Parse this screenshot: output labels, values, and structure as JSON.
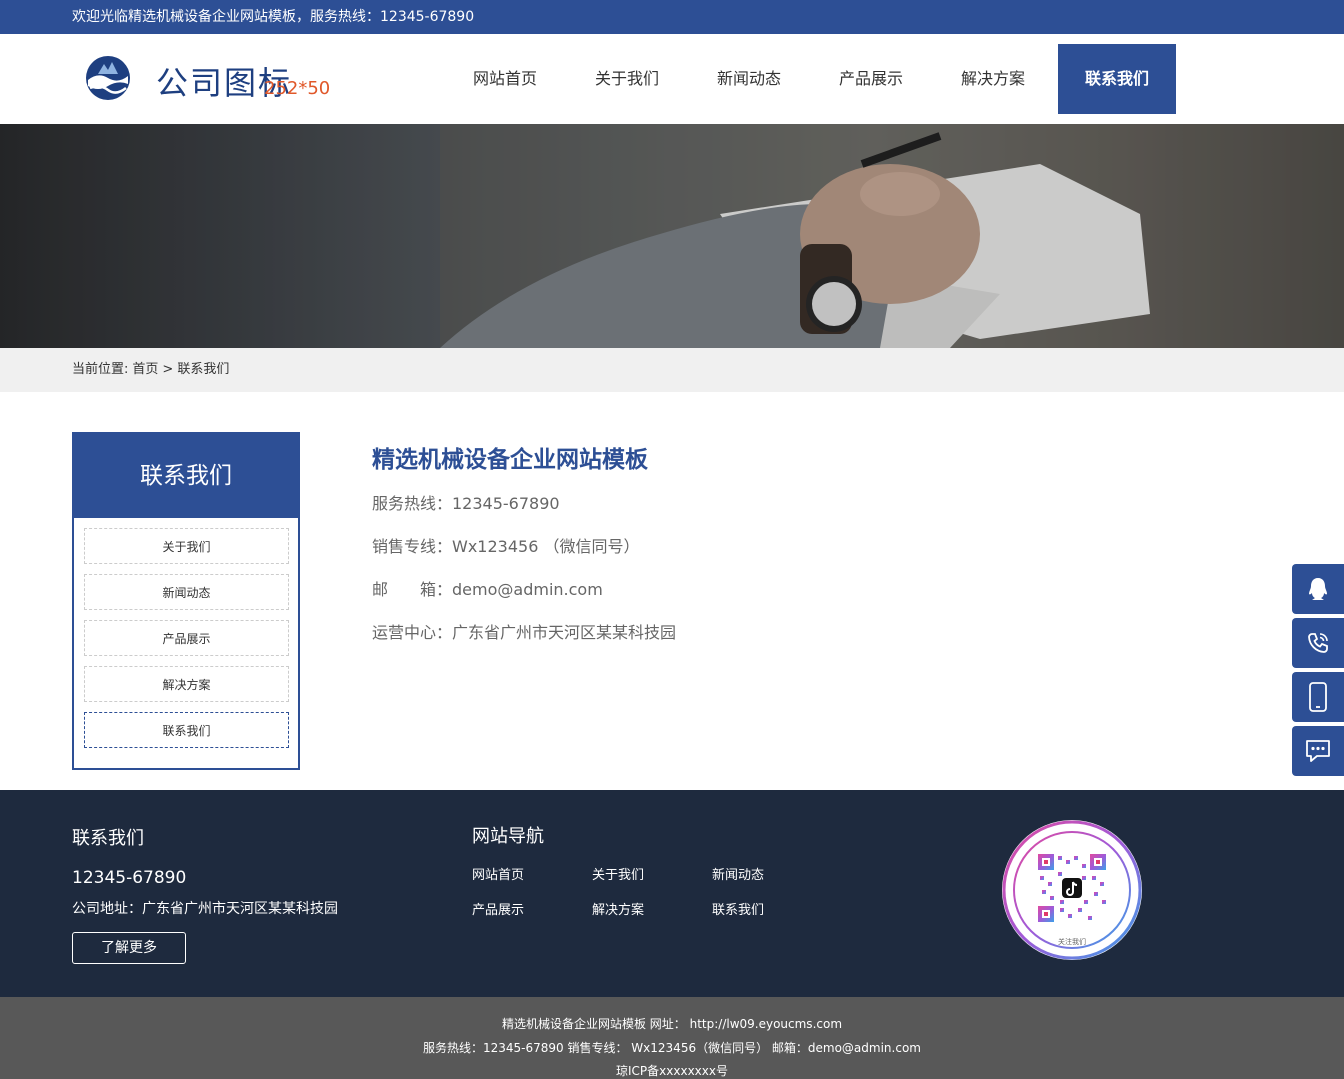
{
  "topbar": {
    "welcome": "欢迎光临精选机械设备企业网站模板，服务热线：12345-67890"
  },
  "header": {
    "logo_text": "公司图标",
    "logo_size": "252*50",
    "nav": [
      "网站首页",
      "关于我们",
      "新闻动态",
      "产品展示",
      "解决方案",
      "联系我们"
    ],
    "active_nav": "联系我们"
  },
  "breadcrumb": {
    "label": "当前位置:",
    "home": "首页",
    "sep": ">",
    "current": "联系我们"
  },
  "sidebar": {
    "title": "联系我们",
    "items": [
      "关于我们",
      "新闻动态",
      "产品展示",
      "解决方案",
      "联系我们"
    ]
  },
  "contact": {
    "title": "精选机械设备企业网站模板",
    "hotline": "服务热线：12345-67890",
    "sales": "销售专线：Wx123456 （微信同号）",
    "email_label": "邮　　箱：",
    "email": "demo@admin.com",
    "address": "运营中心：广东省广州市天河区某某科技园"
  },
  "float_buttons": [
    "qq-icon",
    "phone-icon",
    "mobile-icon",
    "chat-icon"
  ],
  "footer": {
    "col1_title": "联系我们",
    "phone": "12345-67890",
    "address": "公司地址：广东省广州市天河区某某科技园",
    "more": "了解更多",
    "col2_title": "网站导航",
    "nav": [
      "网站首页",
      "关于我们",
      "新闻动态",
      "产品展示",
      "解决方案",
      "联系我们"
    ],
    "qr_caption": "关注我们"
  },
  "bottom": {
    "line1": "精选机械设备企业网站模板 网址： http://lw09.eyoucms.com",
    "line2": "服务热线：12345-67890 销售专线： Wx123456（微信同号） 邮箱：demo@admin.com",
    "line3": "琼ICP备xxxxxxxx号"
  },
  "colors": {
    "primary": "#2d4f95",
    "footer_bg": "#1e2a3e",
    "bottom_bg": "#585858",
    "logo_accent": "#e0582a"
  }
}
